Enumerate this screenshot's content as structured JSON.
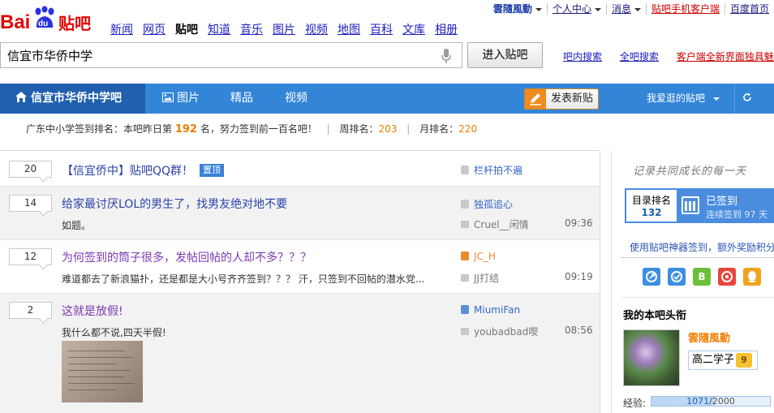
{
  "logo": {
    "text_bai": "Bai",
    "text_du": "du",
    "text_tieba": "贴吧"
  },
  "nav": {
    "items": [
      "新闻",
      "网页",
      "贴吧",
      "知道",
      "音乐",
      "图片",
      "视频",
      "地图",
      "百科",
      "文库",
      "相册"
    ],
    "current": "贴吧"
  },
  "userbar": {
    "username": "雲隨風動",
    "personal_center": "个人中心",
    "messages": "消息",
    "mobile_client": "贴吧手机客户端",
    "homepage": "百度首页"
  },
  "search": {
    "value": "信宜市华侨中学",
    "enter_button": "进入贴吧",
    "in_forum_search": "吧内搜索",
    "global_search": "全吧搜索",
    "promo": "客户端全新界面独具魅力"
  },
  "forum_nav": {
    "forum_name": "信宜市华侨中学吧",
    "tabs": [
      "图片",
      "精品",
      "视频"
    ],
    "post_button": "发表新贴",
    "fav_forums": "我爱逛的贴吧",
    "refresh": "C"
  },
  "rank": {
    "label": "广东中小学签到排名：本吧昨日第",
    "value": "192",
    "suffix": "名，努力签到前一百名吧！",
    "weekly_label": "周排名：",
    "weekly": "203",
    "monthly_label": "月排名：",
    "monthly": "220"
  },
  "threads": [
    {
      "replies": "20",
      "title": "【信宜侨中】贴吧QQ群！",
      "tag": "置顶",
      "author": "栏杆拍不遍",
      "last_reply": "",
      "time": "",
      "abstract": ""
    },
    {
      "replies": "14",
      "title": "给家最讨厌LOL的男生了，找男友绝对地不要",
      "abstract": "如题。",
      "author": "独孤追心",
      "last_reply": "Cruel__闲情",
      "time": "09:36"
    },
    {
      "replies": "12",
      "title": "为何签到的筒子很多，发帖回帖的人却不多？？？",
      "abstract": "难道都去了新浪猫扑，还是都是大小号齐齐签到？？？ 汗，只签到不回帖的潜水党...",
      "author": "JC_H",
      "last_reply": "JJ打结",
      "time": "09:19"
    },
    {
      "replies": "2",
      "title": "这就是放假!",
      "abstract": "我什么都不说,四天半假!",
      "author": "MiumiFan",
      "last_reply": "youbadbad喫",
      "time": "08:56"
    }
  ],
  "sidebar": {
    "slogan": "记录共同成长的每一天",
    "sign_rank_label": "目录排名",
    "sign_rank_value": "132",
    "signed_label": "已签到",
    "signed_days": "连续签到 97 天",
    "sign_tip": "使用贴吧神器签到，额外奖励积分",
    "apps": [
      "icon1",
      "icon2",
      "B",
      "icon4",
      "icon5"
    ],
    "my_title_heading": "我的本吧头衔",
    "username": "雲隨風動",
    "level_name": "高二学子",
    "level": "9",
    "exp_label": "经验:",
    "exp_current": "1071",
    "exp_total": "/2000",
    "exp_fraction": 0.5355
  },
  "colors": {
    "brand_red": "#e10602",
    "brand_blue": "#2932e1",
    "nav_blue": "#3385d8",
    "nav_dark": "#1f5fae",
    "orange": "#f07d00"
  }
}
